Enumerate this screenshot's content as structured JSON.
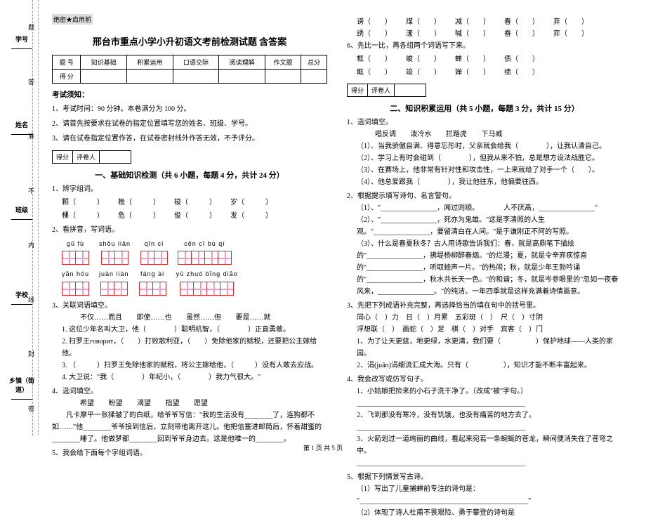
{
  "binding": {
    "fields": [
      "学号",
      "姓名",
      "班级",
      "学校",
      "乡镇（街道）"
    ],
    "spine_chars": [
      "题",
      "答",
      "准",
      "不",
      "内",
      "线",
      "封",
      "密"
    ]
  },
  "classification": "绝密★启用前",
  "title": "邢台市重点小学小升初语文考前检测试题 含答案",
  "score_table": {
    "headers": [
      "题 号",
      "知识基础",
      "积累运用",
      "口语交际",
      "阅读理解",
      "作文题",
      "总分"
    ],
    "row_label": "得 分"
  },
  "notice": {
    "heading": "考试须知：",
    "items": [
      "1、考试时间：90 分钟。本卷满分为 100 分。",
      "2、请首先按要求在试卷的指定位置填写您的姓名、班级、学号。",
      "3、请在试卷指定位置作答，在试卷密封线外作答无效，不予评分。"
    ]
  },
  "score_box": {
    "labels": [
      "得分",
      "评卷人"
    ]
  },
  "part1": {
    "title": "一、基础知识检测（共 6 小题，每题 4 分，共计 24 分）",
    "q1": {
      "stem": "1、辨字组词。",
      "pairs_top": [
        "颗（　　　）",
        "桅（　　　）",
        "梭（　　　）",
        "岁（　　　）"
      ],
      "pairs_bot": [
        "棵（　　　）",
        "危（　　　）",
        "俊（　　　）",
        "发（　　　）"
      ]
    },
    "q2": {
      "stem": "2、看拼音，写词语。",
      "row1": [
        "gū fù",
        "shōu liǎn",
        "qīn cì",
        "cēn cī bù qí"
      ],
      "row1_boxes": [
        2,
        2,
        2,
        4
      ],
      "row2": [
        "yān hóu",
        "juàn liàn",
        "fáng ài",
        "yù zhuó bīng diāo"
      ],
      "row2_boxes": [
        2,
        2,
        2,
        4
      ]
    },
    "q3": {
      "stem": "3、关联词语填空。",
      "bank": [
        "不仅……而且",
        "即使……也",
        "虽然……但",
        "要是……就"
      ],
      "lines": [
        "1. 这位少年名叫大卫，他（　　　　）聪明机智，（　　　　）正直勇敢。",
        "2. 扫罗王говорит，（　　）打败歌利亚，（　　）免除他家的赋税，还要把公主嫁给他。",
        "3. （　　　）扫罗王免除他家的赋税，将公主嫁给他，（　　　）没有人敢去应战。",
        "4. 大卫说：\"我（　　　　）年纪小，（　　　　）我力气很大。\""
      ]
    },
    "q4": {
      "stem": "4、选词填空。",
      "bank": [
        "希望",
        "盼望",
        "渴望",
        "指望",
        "愿望"
      ],
      "para": "　　凡卡摩平一张揉皱了的白纸，给爷爷写信：\"我的生活没有________了，连狗都不如……\"他________爷爷接到信后，立刻带他离开这儿。他把信塞进邮筒后，怀着甜蜜的________睡了。他做梦都________回到爷爷身边去。这是他唯一的________。"
    },
    "q5": {
      "stem": "5、我会给下面每个字组词语。"
    }
  },
  "right_top": {
    "pairs_top": [
      "谤（　　）",
      "煤（　　）",
      "减（　　）",
      "春（　　）",
      "弃（　　）"
    ],
    "pairs_bot": [
      "绣（　　）",
      "漾（　　）",
      "喊（　　）",
      "眷（　　）",
      "弈（　　）"
    ]
  },
  "q6": {
    "stem": "6、先比一比，再各组两个词语写下来。",
    "rows": [
      [
        "框（　　）",
        "峻（　　）",
        "蝉（　　）",
        "债（　　）"
      ],
      [
        "眶（　　）",
        "竣（　　）",
        "婵（　　）",
        "绩（　　）"
      ]
    ]
  },
  "part2": {
    "title": "二、知识积累运用（共 5 小题，每题 3 分，共计 15 分）",
    "q1": {
      "stem": "1、选词填空。",
      "bank": [
        "唱反调",
        "泼冷水",
        "拦路虎",
        "下马威"
      ],
      "lines": [
        "（1）、当我骄傲自满、得意忘形时，父亲就会给我（　　　　），让我认清自己。",
        "（2）、学习上有时会碰到（　　　　），但我从来不怕，总是想方设法战胜它。",
        "（3）、在赛场上，他非常有针对性和攻击性，一上来就给了对手一个（　　）。",
        "（4）、他总爱跟我（　　　　），我让他往东，他偏要往西。"
      ]
    },
    "q2": {
      "stem": "2、根据提示填写诗句、名言警句。",
      "lines": [
        "（1）、\"________________，闻过则顺。　　　　人不厌高，________________\"",
        "（2）、\"________________，死亦为鬼雄。\"这是李清照的人生观。\"________________，要留清白在人间。\"是于谦刚正不阿的写照。",
        "（3）、什么是春夏秋冬？古人用诗歌告诉我们：春，就是高鼎笔下描绘的\"________________，拂堤杨柳醉春烟。\"的烂漫；夏，就是令辛弃疾惊喜的\"________________，听取蛙声一片。\"的热闹；秋，就是少年王勃吟诵的\"________________，秋水共长天一色。\"的和谐；冬，就是岑参眼里的\"忽如一夜春风来，________________。\"的纯洁。一年四季就是这样充满着诗情画意。"
      ]
    },
    "q3": {
      "stem": "3、先把下列成语补充完整，再选择恰当的填在句中的括号里。",
      "rows": [
        "同心（　）力　日（　）月累　五彩斑（　）　尺（　）寸阴",
        "浮想联（　）　画蛇（　）足　棋（　）对手　宾客（　）门"
      ],
      "lines": [
        "1、为了让天更蓝，地更绿，水更清，我们要（　　　　　）保护地球——人类的家园。",
        "2、涓(juān)涓细流汇成大海。只有（　　　　　），知识才能不断丰富起来。"
      ]
    },
    "q4": {
      "stem": "4、我会改写或仿写句子。",
      "lines": [
        "1、小姑娘把捡来的小石子洗干净了。（改成\"被\"字句。）",
        "________________________________________________",
        "2、飞到那没有寒冷，没有饥饿，也没有痛苦的地方去了。",
        "________________________________________________",
        "3、火箭划过一道绚丽的曲线，看起来宛若一条蜿蜒的苍龙，瞬间便消失在了苍穹之中。",
        "________________________________________________"
      ]
    },
    "q5": {
      "stem": "5、根据下列情景写古诗。",
      "lines": [
        "（1）写出了儿童捕蝉前专注的诗句是：",
        "\"________________________________________________\"",
        "（2）体现了诗人杜甫不畏艰险、勇于攀登的诗句是"
      ]
    }
  },
  "footer": "第 1 页 共 5 页"
}
